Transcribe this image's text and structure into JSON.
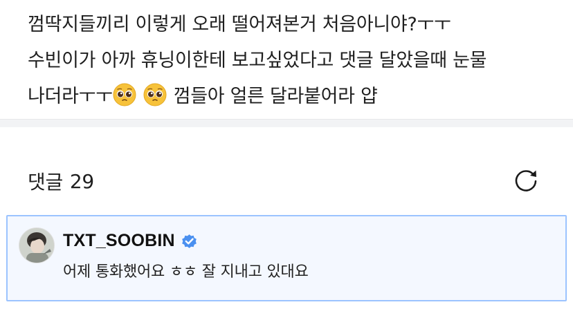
{
  "post": {
    "lines": [
      "껌딱지들끼리 이렇게 오래 떨어져본거 처음아니야?ㅜㅜ",
      "수빈이가 아까 휴닝이한테 보고싶었다고 댓글 달았을때 눈물",
      "나더라ㅜㅜ",
      "껌들아 얼른 달라붙어라 얍"
    ],
    "emojis": [
      "pleading-face",
      "pleading-face"
    ]
  },
  "comments": {
    "label": "댓글",
    "count": "29",
    "refresh_icon": "refresh-icon"
  },
  "highlighted_comment": {
    "author": "TXT_SOOBIN",
    "verified": true,
    "text": "어제 통화했어요 ㅎㅎ 잘 지내고 있대요",
    "accent_color": "#4a90f0",
    "border_color": "#9bc3ff",
    "background_color": "#f4f8ff"
  }
}
